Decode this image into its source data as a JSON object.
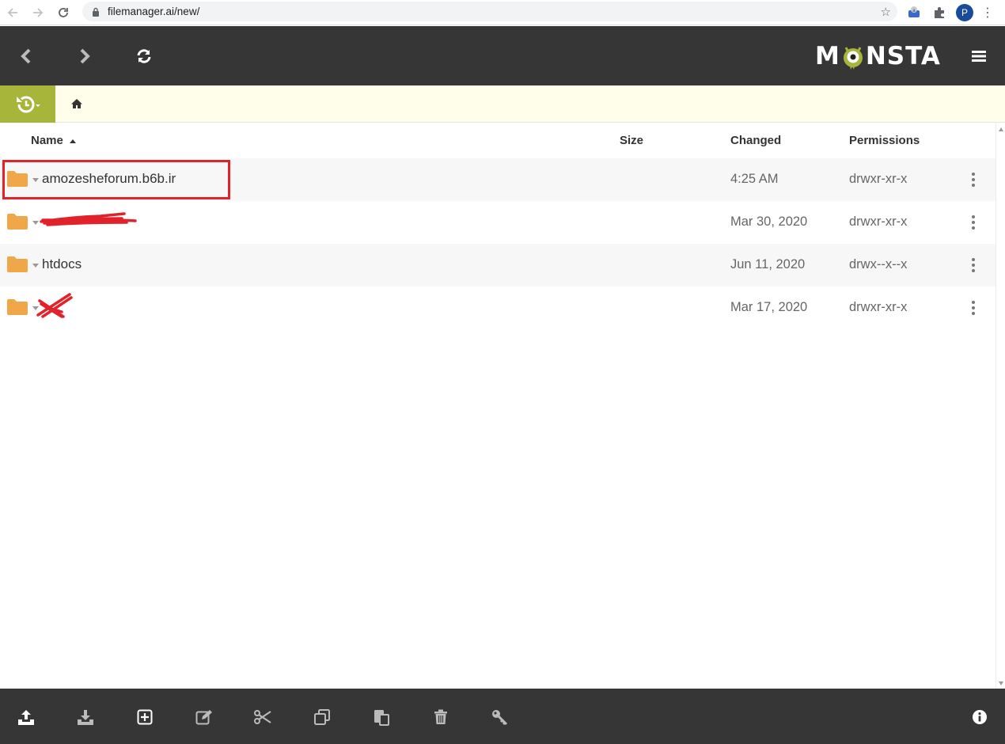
{
  "browser": {
    "url": "filemanager.ai/new/",
    "profile_initial": "P"
  },
  "app": {
    "logo_text_left": "M",
    "logo_text_right": "NSTA",
    "colors": {
      "header_bg": "#363636",
      "accent": "#a7b53a",
      "folder": "#f0a74a",
      "highlight": "#e2222b"
    }
  },
  "table": {
    "headers": {
      "name": "Name",
      "size": "Size",
      "changed": "Changed",
      "permissions": "Permissions"
    },
    "sort": {
      "column": "name",
      "direction": "ascending"
    },
    "rows": [
      {
        "name": "amozesheforum.b6b.ir",
        "size": "",
        "changed": "4:25 AM",
        "permissions": "drwxr-xr-x"
      },
      {
        "name": "",
        "size": "",
        "changed": "Mar 30, 2020",
        "permissions": "drwxr-xr-x"
      },
      {
        "name": "htdocs",
        "size": "",
        "changed": "Jun 11, 2020",
        "permissions": "drwx--x--x"
      },
      {
        "name": "",
        "size": "",
        "changed": "Mar 17, 2020",
        "permissions": "drwxr-xr-x"
      }
    ]
  },
  "footer": {
    "tools": [
      "upload-icon",
      "download-icon",
      "new-item-icon",
      "edit-icon",
      "cut-icon",
      "copy-icon",
      "paste-icon",
      "delete-icon",
      "key-icon",
      "info-icon"
    ]
  }
}
